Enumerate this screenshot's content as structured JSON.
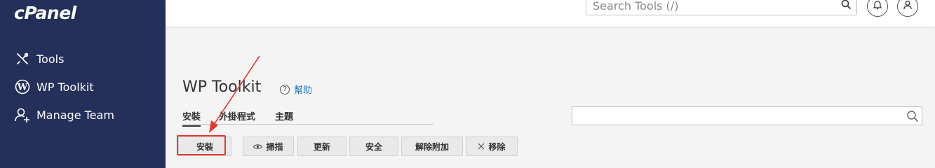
{
  "sidebar": {
    "logo": "cPanel",
    "items": [
      {
        "label": "Tools",
        "icon": "tools-icon"
      },
      {
        "label": "WP Toolkit",
        "icon": "wordpress-icon"
      },
      {
        "label": "Manage Team",
        "icon": "manage-team-icon"
      }
    ]
  },
  "header": {
    "search_placeholder": "Search Tools (/)"
  },
  "main": {
    "title": "WP Toolkit",
    "help_label": "幫助",
    "tabs": [
      {
        "label": "安裝",
        "active": true
      },
      {
        "label": "外掛程式",
        "active": false
      },
      {
        "label": "主題",
        "active": false
      }
    ],
    "buttons": {
      "install": "安裝",
      "scan": "掃描",
      "update": "更新",
      "security": "安全",
      "detach": "解除附加",
      "remove": "移除"
    }
  },
  "colors": {
    "sidebar_bg": "#25305a",
    "link": "#1b79b8",
    "highlight": "#e43a2e"
  }
}
